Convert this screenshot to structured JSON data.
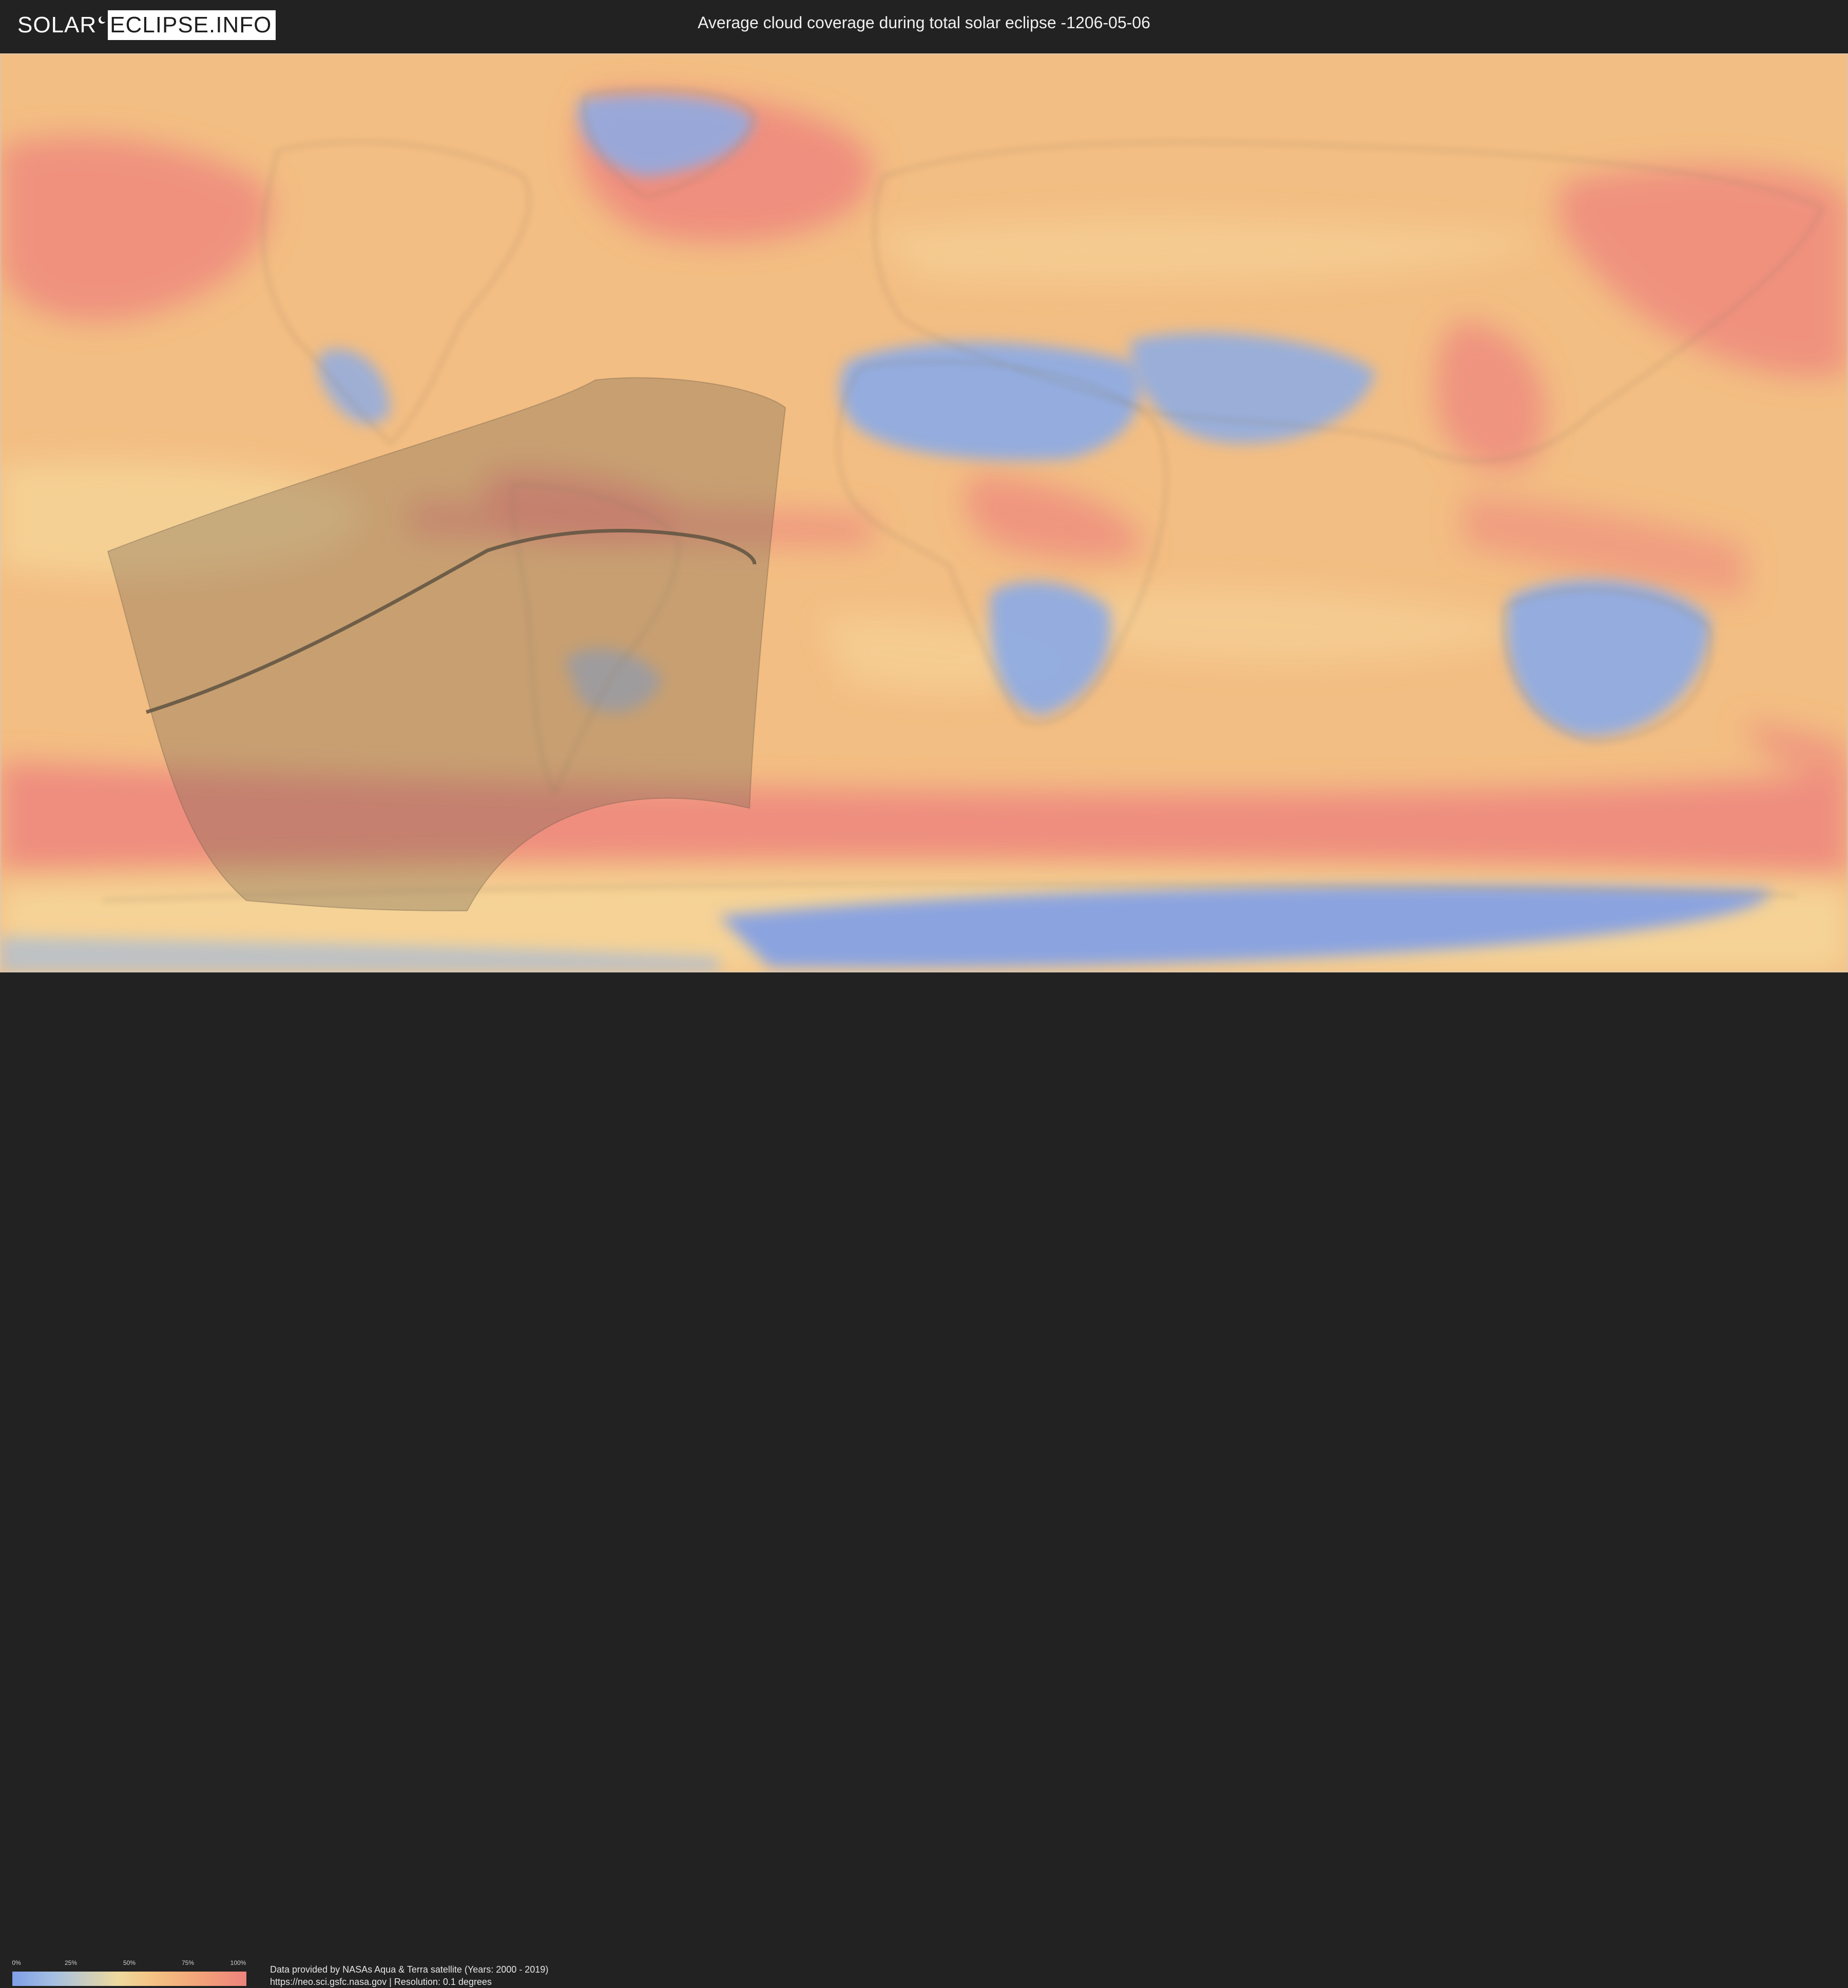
{
  "header": {
    "logo_part1": "SOLAR",
    "logo_part2": "ECLIPSE.INFO",
    "title": "Average cloud coverage during total solar eclipse -1206-05-06"
  },
  "map": {
    "type": "world cloud coverage map",
    "projection": "equirectangular",
    "overlays": [
      "eclipse visibility zone",
      "path of totality"
    ]
  },
  "legend": {
    "ticks": [
      "0%",
      "25%",
      "50%",
      "75%",
      "100%"
    ],
    "colors": [
      "#7f9fe8",
      "#eeda9e",
      "#f4c383",
      "#ee837d"
    ]
  },
  "credits": {
    "line1": "Data provided by NASAs Aqua & Terra satellite (Years: 2000 - 2019)",
    "line2": "https://neo.sci.gsfc.nasa.gov | Resolution: 0.1 degrees"
  },
  "colors": {
    "background": "#222222",
    "land_clear": "#8aabe8",
    "cloudy_ocean": "#ee8a7e",
    "mid_cloud": "#f3be83"
  }
}
